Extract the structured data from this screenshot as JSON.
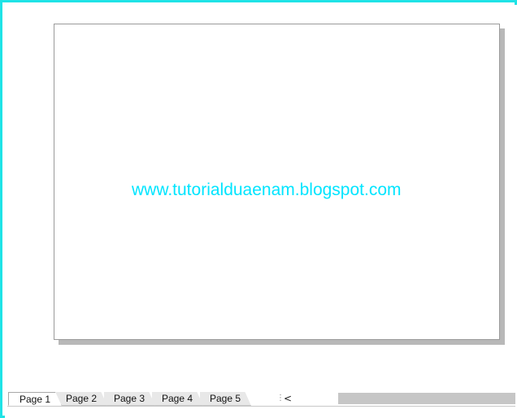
{
  "watermark": {
    "text": "www.tutorialduaenam.blogspot.com",
    "color": "#00e5ff"
  },
  "frame": {
    "border_color": "#1fe3e6"
  },
  "tabs": [
    {
      "label": "Page 1",
      "active": true
    },
    {
      "label": "Page 2",
      "active": false
    },
    {
      "label": "Page 3",
      "active": false
    },
    {
      "label": "Page 4",
      "active": false
    },
    {
      "label": "Page 5",
      "active": false
    }
  ],
  "controls": {
    "splitter_glyph": "⋮",
    "scroll_left_glyph": "<"
  },
  "icons": {
    "splitter": "vertical-dots-icon",
    "scroll_left": "chevron-left-icon"
  }
}
